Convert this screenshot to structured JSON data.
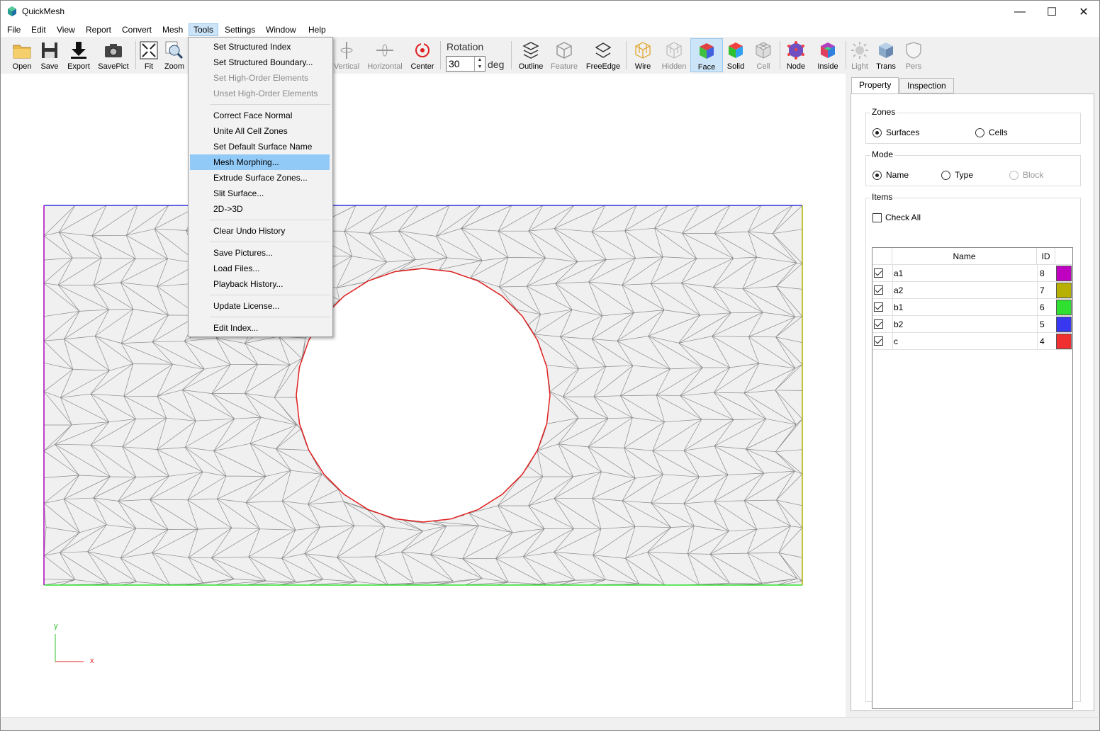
{
  "window": {
    "title": "QuickMesh",
    "controls": [
      "—",
      "☐",
      "✕"
    ]
  },
  "menubar": [
    {
      "label": "File"
    },
    {
      "label": "Edit"
    },
    {
      "label": "View"
    },
    {
      "label": "Report"
    },
    {
      "label": "Convert"
    },
    {
      "label": "Mesh"
    },
    {
      "label": "Tools",
      "active": true
    },
    {
      "label": "Settings"
    },
    {
      "label": "Window"
    },
    {
      "label": "Help"
    }
  ],
  "toolbar": {
    "buttons": {
      "open": "Open",
      "save": "Save",
      "export": "Export",
      "savepict": "SavePict",
      "fit": "Fit",
      "zoom": "Zoom",
      "vertical": "Vertical",
      "horizontal": "Horizontal",
      "center": "Center",
      "outline": "Outline",
      "feature": "Feature",
      "freeedge": "FreeEdge",
      "wire": "Wire",
      "hidden": "Hidden",
      "face": "Face",
      "solid": "Solid",
      "cell": "Cell",
      "node": "Node",
      "inside": "Inside",
      "light": "Light",
      "trans": "Trans",
      "pers": "Pers"
    },
    "rotation": {
      "label": "Rotation",
      "value": "30",
      "unit": "deg"
    }
  },
  "tools_menu": {
    "items": [
      {
        "label": "Set Structured Index",
        "enabled": true
      },
      {
        "label": "Set Structured Boundary...",
        "enabled": true
      },
      {
        "label": "Set High-Order Elements",
        "enabled": false
      },
      {
        "label": "Unset High-Order Elements",
        "enabled": false
      },
      {
        "label": "Correct Face Normal",
        "enabled": true
      },
      {
        "label": "Unite All Cell Zones",
        "enabled": true
      },
      {
        "label": "Set Default Surface Name",
        "enabled": true
      },
      {
        "label": "Mesh Morphing...",
        "enabled": true,
        "highlighted": true
      },
      {
        "label": "Extrude Surface Zones...",
        "enabled": true
      },
      {
        "label": "Slit Surface...",
        "enabled": true
      },
      {
        "label": "2D->3D",
        "enabled": true
      },
      {
        "label": "Clear Undo History",
        "enabled": true
      },
      {
        "label": "Save Pictures...",
        "enabled": true
      },
      {
        "label": "Load Files...",
        "enabled": true
      },
      {
        "label": "Playback History...",
        "enabled": true
      },
      {
        "label": "Update License...",
        "enabled": true
      },
      {
        "label": "Edit Index...",
        "enabled": true
      }
    ]
  },
  "viewport": {
    "axis": {
      "y": "y",
      "x": "x"
    },
    "boundary_colors": {
      "left": "#b000c0",
      "top": "#3030e0",
      "right": "#b0b000",
      "bottom": "#30e030",
      "hole": "#e02020"
    }
  },
  "panel": {
    "tabs": [
      {
        "label": "Property",
        "active": true
      },
      {
        "label": "Inspection",
        "active": false
      }
    ],
    "zones": {
      "title": "Zones",
      "surfaces": "Surfaces",
      "cells": "Cells",
      "selected": "Surfaces"
    },
    "mode": {
      "title": "Mode",
      "name": "Name",
      "type": "Type",
      "block": "Block",
      "selected": "Name"
    },
    "items": {
      "title": "Items",
      "check_all": "Check All",
      "columns": {
        "name": "Name",
        "id": "ID"
      },
      "rows": [
        {
          "name": "a1",
          "id": "8",
          "color": "#c000c0",
          "checked": true
        },
        {
          "name": "a2",
          "id": "7",
          "color": "#b8b000",
          "checked": true
        },
        {
          "name": "b1",
          "id": "6",
          "color": "#30e030",
          "checked": true
        },
        {
          "name": "b2",
          "id": "5",
          "color": "#3838f0",
          "checked": true
        },
        {
          "name": "c",
          "id": "4",
          "color": "#f03030",
          "checked": true
        }
      ]
    }
  }
}
